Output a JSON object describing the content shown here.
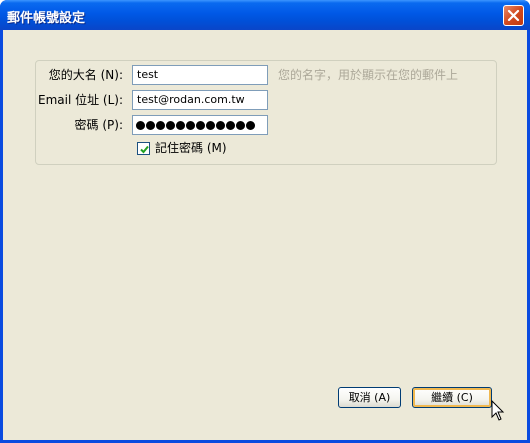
{
  "window": {
    "title": "郵件帳號設定"
  },
  "form": {
    "name_label": "您的大名 (N):",
    "name_value": "test",
    "name_hint": "您的名字，用於顯示在您的郵件上",
    "email_label": "Email 位址 (L):",
    "email_value": "test@rodan.com.tw",
    "password_label": "密碼 (P):",
    "password_dot_count": 12,
    "remember_label": "記住密碼 (M)",
    "remember_checked": true
  },
  "buttons": {
    "cancel_label": "取消 (A)",
    "continue_label": "繼續 (C)"
  },
  "colors": {
    "titlebar": "#0058e6",
    "dialog_bg": "#ece9d8",
    "input_border": "#7f9db9",
    "hint_text": "#aca899",
    "default_button_glow": "#f0b850"
  }
}
